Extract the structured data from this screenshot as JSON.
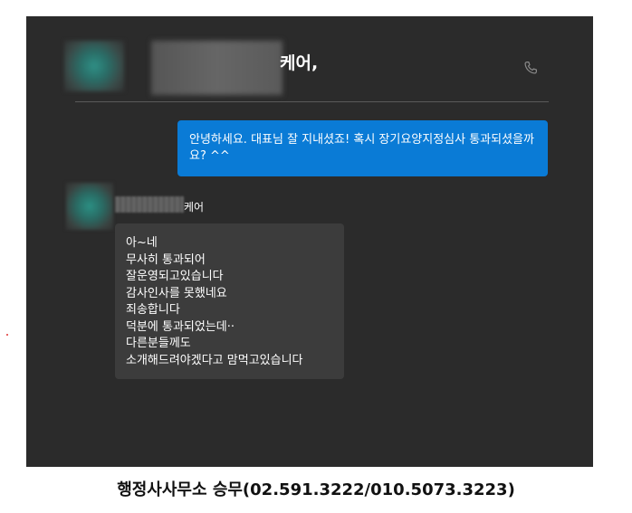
{
  "header": {
    "contact_name_suffix": "케어,",
    "call_icon": "phone-icon"
  },
  "messages": {
    "outgoing": {
      "text": "안녕하세요. 대표님 잘 지내셨죠! 혹시 장기요양지정심사 통과되셨을까요? ^^"
    },
    "incoming": {
      "sender_name_suffix": "케어",
      "lines": [
        "아~네",
        "무사히 통과되어",
        "잘운영되고있습니다",
        "감사인사를 못했네요",
        "죄송합니다",
        "덕분에 통과되었는데··",
        "다른분들께도",
        "소개해드려야겠다고 맘먹고있습니다"
      ]
    }
  },
  "caption": {
    "text": "행정사사무소 승무(02.591.3222/010.5073.3223)"
  },
  "colors": {
    "chat_background": "#2b2b2b",
    "outgoing_bubble": "#0a7bd6",
    "incoming_bubble": "#3c3c3c"
  }
}
